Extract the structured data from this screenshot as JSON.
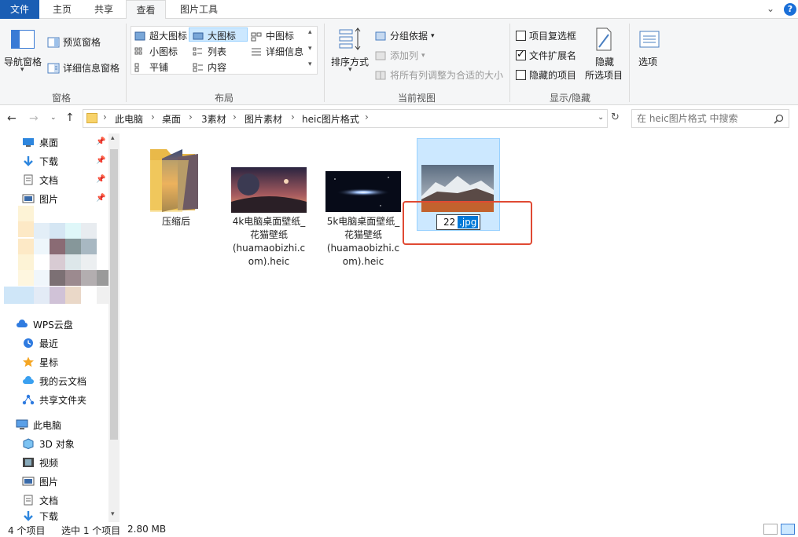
{
  "ribbon_tabs": [
    {
      "label": "文件",
      "style": "file"
    },
    {
      "label": "主页",
      "style": "normal"
    },
    {
      "label": "共享",
      "style": "normal"
    },
    {
      "label": "查看",
      "style": "active"
    },
    {
      "label": "图片工具",
      "style": "normal"
    }
  ],
  "ribbon": {
    "pane": {
      "nav_pane": "导航窗格",
      "preview_pane": "预览窗格",
      "details_pane": "详细信息窗格",
      "group": "窗格"
    },
    "layout": {
      "extra_large": "超大图标",
      "large": "大图标",
      "medium": "中图标",
      "small": "小图标",
      "list": "列表",
      "details": "详细信息",
      "tiles": "平铺",
      "content": "内容",
      "group": "布局"
    },
    "current_view": {
      "sort_by": "排序方式",
      "group_by": "分组依据",
      "add_columns": "添加列",
      "size_all_columns": "将所有列调整为合适的大小",
      "group": "当前视图"
    },
    "show_hide": {
      "item_checkboxes": "项目复选框",
      "item_checkboxes_checked": false,
      "file_extensions": "文件扩展名",
      "file_extensions_checked": true,
      "hidden_items": "隐藏的项目",
      "hidden_items_checked": false,
      "hide_selected_line1": "隐藏",
      "hide_selected_line2": "所选项目",
      "group": "显示/隐藏"
    },
    "options": "选项"
  },
  "address": {
    "crumbs": [
      "此电脑",
      "桌面",
      "3素材",
      "图片素材",
      "heic图片格式"
    ],
    "search_placeholder": "在 heic图片格式 中搜索"
  },
  "nav": {
    "quick": [
      {
        "label": "桌面",
        "icon": "desktop-icon"
      },
      {
        "label": "下载",
        "icon": "download-icon"
      },
      {
        "label": "文档",
        "icon": "document-icon"
      },
      {
        "label": "图片",
        "icon": "pictures-icon"
      }
    ],
    "cloud": [
      {
        "label": "WPS云盘",
        "icon": "cloud-icon"
      },
      {
        "label": "最近",
        "icon": "clock-icon"
      },
      {
        "label": "星标",
        "icon": "star-icon"
      },
      {
        "label": "我的云文档",
        "icon": "cloud-doc-icon"
      },
      {
        "label": "共享文件夹",
        "icon": "share-icon"
      }
    ],
    "pc": {
      "label": "此电脑",
      "icon": "computer-icon"
    },
    "pc_items": [
      {
        "label": "3D 对象",
        "icon": "cube-icon"
      },
      {
        "label": "视频",
        "icon": "video-icon"
      },
      {
        "label": "图片",
        "icon": "pictures-icon"
      },
      {
        "label": "文档",
        "icon": "document-icon"
      },
      {
        "label": "下载",
        "icon": "download-icon"
      }
    ]
  },
  "files": [
    {
      "name": "压缩后",
      "type": "folder"
    },
    {
      "name_lines": [
        "4k电脑桌面壁纸_",
        "花猫壁纸",
        "(huamaobizhi.c",
        "om).heic"
      ],
      "type": "image",
      "thumb": "planet"
    },
    {
      "name_lines": [
        "5k电脑桌面壁纸_",
        "花猫壁纸",
        "(huamaobizhi.c",
        "om).heic"
      ],
      "type": "image",
      "thumb": "galaxy"
    },
    {
      "rename_prefix": "22",
      "rename_selected": ".jpg",
      "type": "image",
      "thumb": "mountain",
      "selected": true
    }
  ],
  "status": {
    "count": "4 个项目",
    "selection": "选中 1 个项目",
    "size": "2.80 MB"
  },
  "colors": {
    "file_tab": "#1a5eb4",
    "selection_bg": "#cce8ff",
    "highlight_box": "#e04a33",
    "help": "#1a6fd8"
  }
}
